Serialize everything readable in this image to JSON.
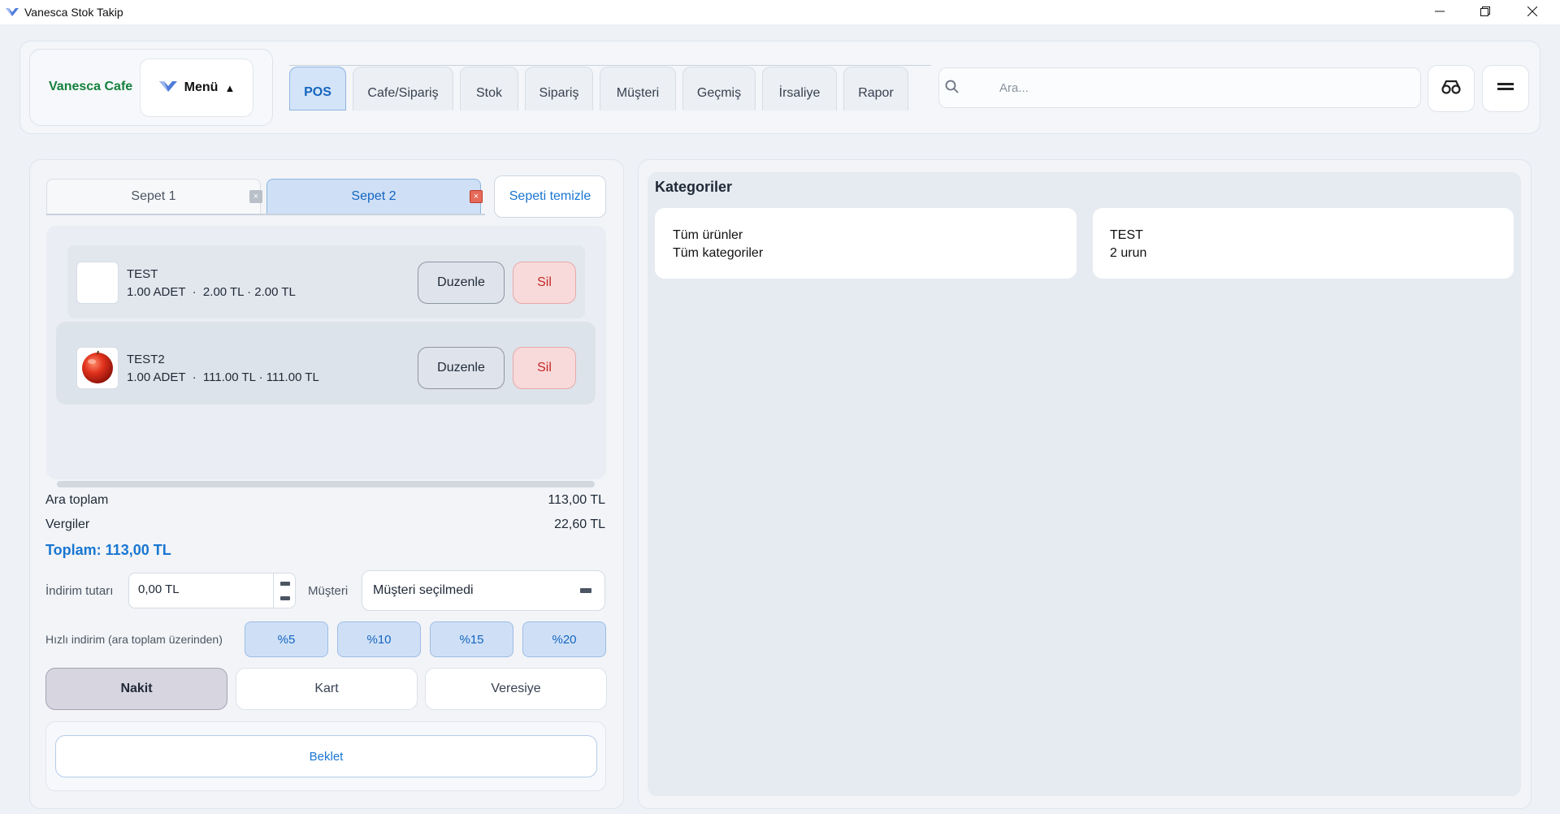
{
  "window": {
    "title": "Vanesca Stok Takip",
    "app_icon": "vanesca-logo-icon"
  },
  "header": {
    "brand_name": "Vanesca Cafe",
    "menu_label": "Menü",
    "menu_caret": "▲",
    "tabs": [
      {
        "label": "POS",
        "active": true
      },
      {
        "label": "Cafe/Sipariş",
        "active": false
      },
      {
        "label": "Stok",
        "active": false
      },
      {
        "label": "Sipariş",
        "active": false
      },
      {
        "label": "Müşteri",
        "active": false
      },
      {
        "label": "Geçmiş",
        "active": false
      },
      {
        "label": "İrsaliye",
        "active": false
      },
      {
        "label": "Rapor",
        "active": false
      }
    ],
    "search_placeholder": "Ara...",
    "buttons": [
      "glasses-icon",
      "hamburger-menu-icon"
    ]
  },
  "cart": {
    "tabs": [
      {
        "label": "Sepet 1",
        "active": false,
        "close": "×"
      },
      {
        "label": "Sepet 2",
        "active": true,
        "close": "×"
      }
    ],
    "clear_label": "Sepeti temizle",
    "items": [
      {
        "name": "TEST",
        "meta": "1.00 ADET  ·  2.00 TL · 2.00 TL",
        "image": "blank",
        "edit_label": "Duzenle",
        "delete_label": "Sil"
      },
      {
        "name": "TEST2",
        "meta": "1.00 ADET  ·  111.00 TL · 111.00 TL",
        "image": "apple",
        "edit_label": "Duzenle",
        "delete_label": "Sil"
      }
    ]
  },
  "summary": {
    "subtotal_label": "Ara toplam",
    "subtotal_value": "113,00 TL",
    "tax_label": "Vergiler",
    "tax_value": "22,60 TL",
    "total_text": "Toplam: 113,00 TL"
  },
  "discount": {
    "label": "İndirim tutarı",
    "value": "0,00 TL",
    "customer_label": "Müşteri",
    "customer_value": "Müşteri seçilmedi",
    "quick_label": "Hızlı indirim (ara toplam üzerinden)",
    "quick_options": [
      "%5",
      "%10",
      "%15",
      "%20"
    ]
  },
  "payment": {
    "methods": [
      {
        "label": "Nakit",
        "selected": true
      },
      {
        "label": "Kart",
        "selected": false
      },
      {
        "label": "Veresiye",
        "selected": false
      }
    ],
    "hold_label": "Beklet"
  },
  "categories": {
    "title": "Kategoriler",
    "items": [
      {
        "name": "Tüm ürünler",
        "sub": "Tüm kategoriler"
      },
      {
        "name": "TEST",
        "sub": "2 urun"
      }
    ]
  },
  "colors": {
    "accent": "#1976d2",
    "brand": "#15803d",
    "danger": "#c62828"
  }
}
